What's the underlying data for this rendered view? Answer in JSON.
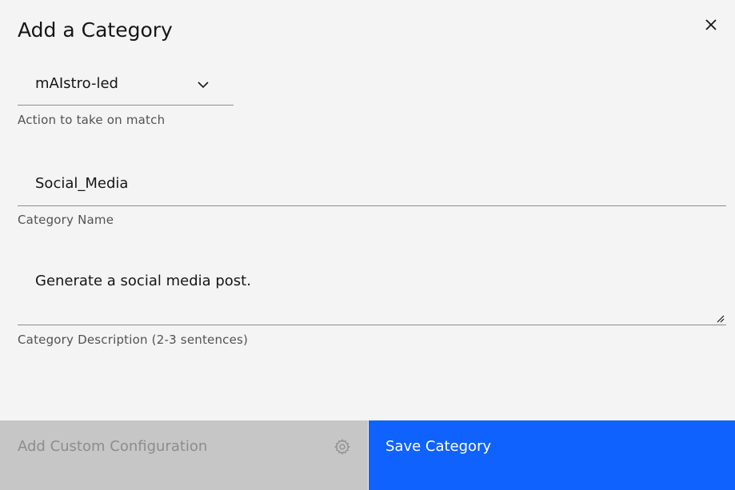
{
  "modal": {
    "title": "Add a Category",
    "close_icon": "close-icon"
  },
  "action_select": {
    "value": "mAIstro-led",
    "helper": "Action to take on match",
    "icon": "chevron-down-icon"
  },
  "category_name": {
    "value": "Social_Media",
    "helper": "Category Name"
  },
  "category_description": {
    "value": "Generate a social media post.",
    "helper": "Category Description (2-3 sentences)"
  },
  "footer": {
    "secondary_label": "Add Custom Configuration",
    "secondary_icon": "gear-icon",
    "primary_label": "Save Category"
  },
  "colors": {
    "background": "#f4f4f4",
    "primary": "#0f62fe",
    "disabled_bg": "#c6c6c6",
    "disabled_text": "#8d8d8d",
    "helper_text": "#525252"
  }
}
